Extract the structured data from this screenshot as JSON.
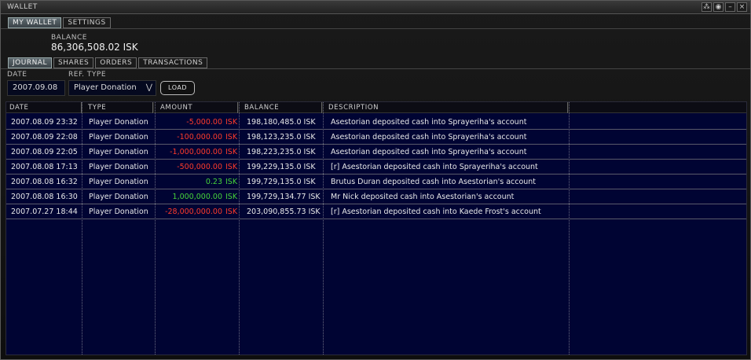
{
  "window": {
    "title": "WALLET"
  },
  "top_tabs": [
    {
      "label": "MY WALLET",
      "active": true
    },
    {
      "label": "SETTINGS",
      "active": false
    }
  ],
  "balance": {
    "label": "BALANCE",
    "value": "86,306,508.02 ISK"
  },
  "sub_tabs": [
    {
      "label": "JOURNAL",
      "active": true
    },
    {
      "label": "SHARES",
      "active": false
    },
    {
      "label": "ORDERS",
      "active": false
    },
    {
      "label": "TRANSACTIONS",
      "active": false
    }
  ],
  "filters": {
    "date_label": "DATE",
    "date_value": "2007.09.08",
    "reftype_label": "REF. TYPE",
    "reftype_value": "Player Donation",
    "load_label": "LOAD"
  },
  "table": {
    "headers": [
      "DATE",
      "TYPE",
      "AMOUNT",
      "BALANCE",
      "DESCRIPTION"
    ],
    "rows": [
      {
        "date": "2007.08.09  23:32",
        "type": "Player Donation",
        "amount": "-5,000.00",
        "amount_sign": "neg",
        "isk": "ISK",
        "balance": "198,180,485.0  ISK",
        "description": "Asestorian deposited cash into Sprayeriha's account"
      },
      {
        "date": "2007.08.09  22:08",
        "type": "Player Donation",
        "amount": "-100,000.00",
        "amount_sign": "neg",
        "isk": "ISK",
        "balance": "198,123,235.0  ISK",
        "description": "Asestorian deposited cash into Sprayeriha's account"
      },
      {
        "date": "2007.08.09  22:05",
        "type": "Player Donation",
        "amount": "-1,000,000.00",
        "amount_sign": "neg",
        "isk": "ISK",
        "balance": "198,223,235.0  ISK",
        "description": "Asestorian deposited cash into Sprayeriha's account"
      },
      {
        "date": "2007.08.08  17:13",
        "type": "Player Donation",
        "amount": "-500,000.00",
        "amount_sign": "neg",
        "isk": "ISK",
        "balance": "199,229,135.0  ISK",
        "description": "[r]  Asestorian deposited cash into Sprayeriha's account"
      },
      {
        "date": "2007.08.08  16:32",
        "type": "Player Donation",
        "amount": "0.23",
        "amount_sign": "pos",
        "isk": "ISK",
        "balance": "199,729,135.0  ISK",
        "description": "Brutus Duran deposited cash into Asestorian's account"
      },
      {
        "date": "2007.08.08  16:30",
        "type": "Player Donation",
        "amount": "1,000,000.00",
        "amount_sign": "pos",
        "isk": "ISK",
        "balance": "199,729,134.77  ISK",
        "description": "Mr Nick deposited cash into Asestorian's account"
      },
      {
        "date": "2007.07.27  18:44",
        "type": "Player Donation",
        "amount": "-28,000,000.00",
        "amount_sign": "neg",
        "isk": "ISK",
        "balance": "203,090,855.73  ISK",
        "description": "[r]  Asestorian deposited cash into Kaede Frost's account"
      }
    ]
  },
  "colors": {
    "negative": "#ff3b2a",
    "positive": "#46d33a",
    "table_bg": "#000433"
  },
  "icons": [
    "pin-icon",
    "minimize-icon",
    "close-icon"
  ]
}
